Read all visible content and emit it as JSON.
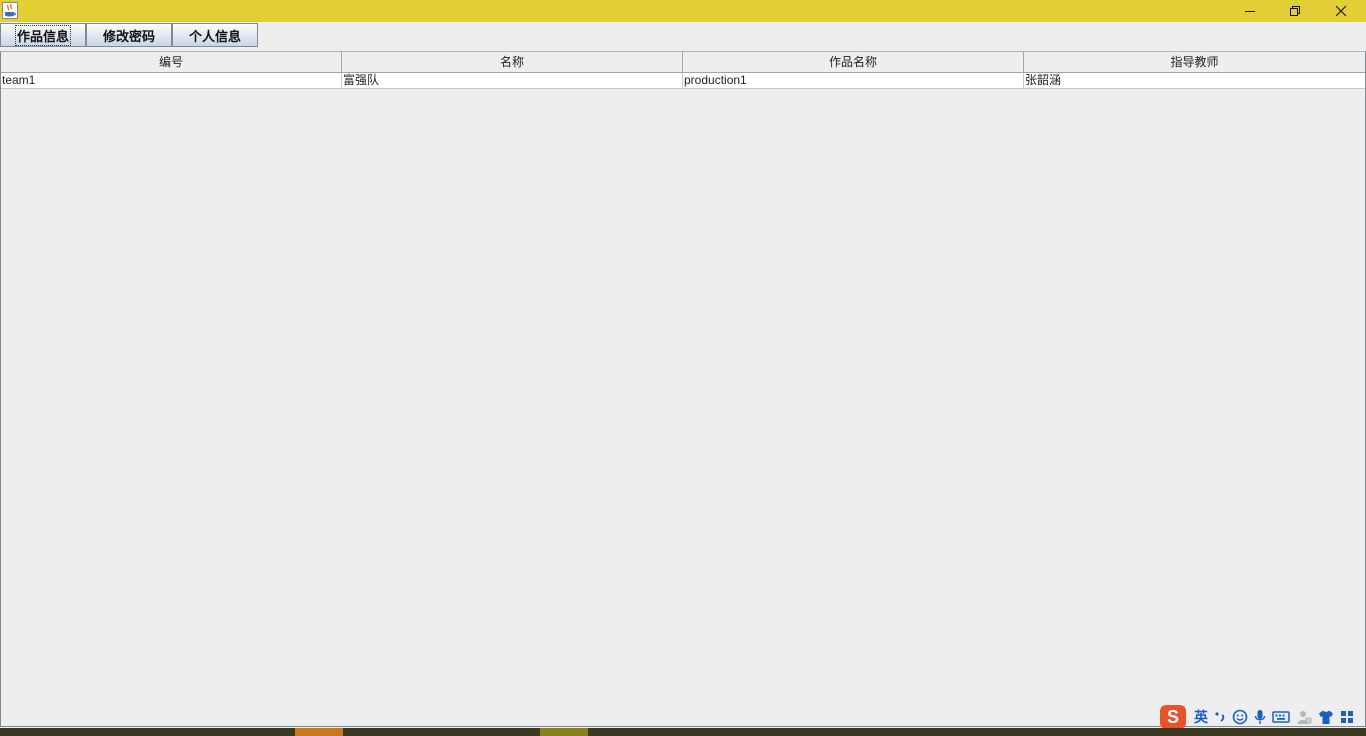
{
  "window": {
    "minimize_icon": "minimize-icon",
    "restore_icon": "restore-icon",
    "close_icon": "close-icon",
    "title_bar_color": "#e2cf35"
  },
  "toolbar": {
    "tabs": [
      {
        "label": "作品信息",
        "active": true
      },
      {
        "label": "修改密码",
        "active": false
      },
      {
        "label": "个人信息",
        "active": false
      }
    ]
  },
  "table": {
    "columns": [
      "编号",
      "名称",
      "作品名称",
      "指导教师"
    ],
    "rows": [
      [
        "team1",
        "富强队",
        "production1",
        "张韶涵"
      ]
    ]
  },
  "ime": {
    "logo": "S",
    "mode": "英",
    "icons": [
      "punctuation-icon",
      "emoji-icon",
      "microphone-icon",
      "keyboard-icon",
      "user-icon",
      "skin-icon",
      "grid-icon"
    ]
  }
}
